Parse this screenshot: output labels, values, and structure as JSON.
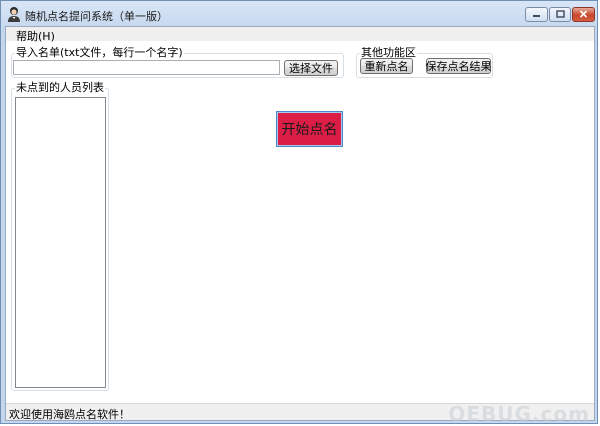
{
  "window": {
    "title": "随机点名提问系统（单一版）",
    "app_icon": "person-icon"
  },
  "title_buttons": {
    "minimize_icon": "minimize-icon",
    "maximize_icon": "maximize-icon",
    "close_icon": "close-icon",
    "close_color": "#c8452b"
  },
  "menu": {
    "help": "帮助(H)"
  },
  "import": {
    "group_label": "导入名单(txt文件，每行一个名字)",
    "file_path_value": "",
    "choose_file_label": "选择文件"
  },
  "other_functions": {
    "group_label": "其他功能区",
    "reroll_label": "重新点名",
    "save_results_label": "保存点名结果"
  },
  "absent_list": {
    "group_label": "未点到的人员列表",
    "items": []
  },
  "start_button": {
    "label": "开始点名",
    "color": "#dc1e46"
  },
  "status": {
    "text": "欢迎使用海鸥点名软件！"
  }
}
